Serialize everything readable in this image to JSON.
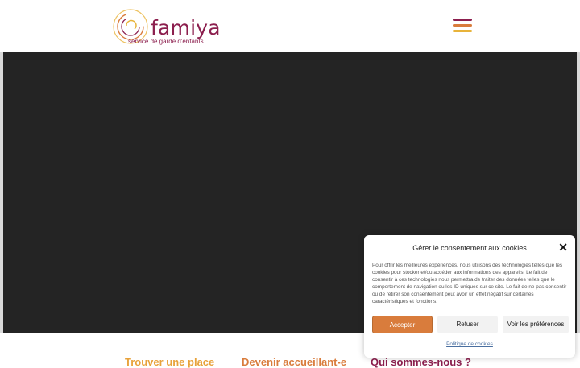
{
  "header": {
    "logo_name": "famiya",
    "logo_tagline": "service de garde d'enfants",
    "menu_icon": "hamburger-menu-icon",
    "menu_colors": [
      "#8c1f4e",
      "#d97c3c",
      "#e8b33a"
    ]
  },
  "hero": {
    "background": "#242424"
  },
  "links": [
    {
      "label": "Trouver une place",
      "color": "#e8a23a"
    },
    {
      "label": "Devenir accueillant-e",
      "color": "#d97c3c"
    },
    {
      "label": "Qui sommes-nous ?",
      "color": "#8c1f4e"
    }
  ],
  "cookie": {
    "title": "Gérer le consentement aux cookies",
    "close_icon": "close-icon",
    "text": "Pour offrir les meilleures expériences, nous utilisons des technologies telles que les cookies pour stocker et/ou accéder aux informations des appareils. Le fait de consentir à ces technologies nous permettra de traiter des données telles que le comportement de navigation ou les ID uniques sur ce site. Le fait de ne pas consentir ou de retirer son consentement peut avoir un effet négatif sur certaines caractéristiques et fonctions.",
    "accept": "Accepter",
    "refuse": "Refuser",
    "preferences": "Voir les préférences",
    "policy": "Politique de cookies"
  }
}
